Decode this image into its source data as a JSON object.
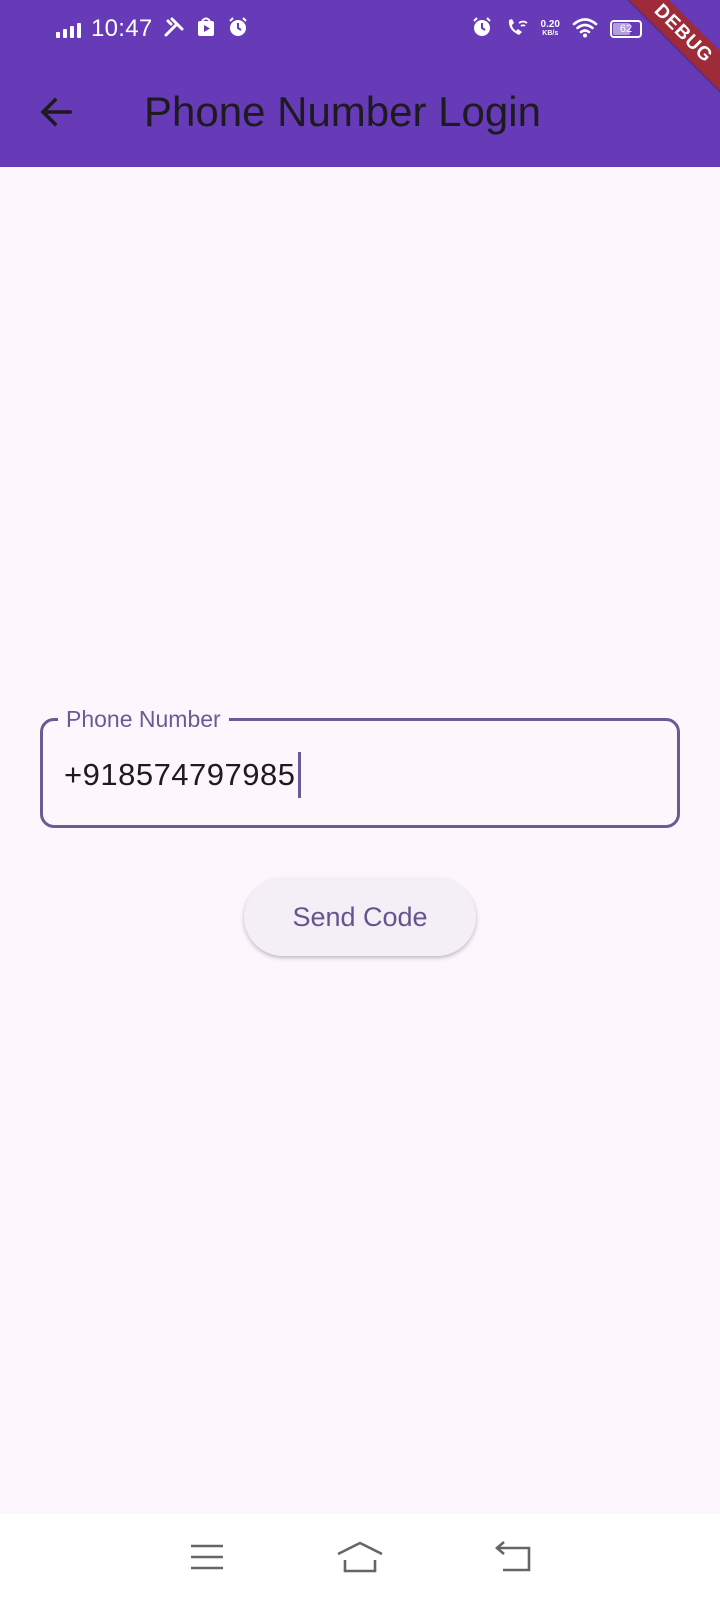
{
  "status_bar": {
    "time": "10:47",
    "net_speed_value": "0.20",
    "net_speed_unit": "KB/s",
    "battery_level": "62",
    "icons": [
      "signal-icon",
      "tools-icon",
      "play-store-icon",
      "alarm-icon",
      "alarm-icon",
      "wifi-call-icon",
      "wifi-icon",
      "battery-icon"
    ]
  },
  "debug_banner": "DEBUG",
  "app_bar": {
    "title": "Phone Number Login",
    "back_icon": "arrow-back-icon"
  },
  "phone_field": {
    "label": "Phone Number",
    "value": "+918574797985"
  },
  "send_button": {
    "label": "Send Code"
  },
  "nav_bar": {
    "icons": [
      "menu-icon",
      "home-icon",
      "back-icon"
    ]
  },
  "colors": {
    "app_bar": "#673AB7",
    "background": "#FDF7FD",
    "field_border": "#6B5B95",
    "button_text": "#65558F",
    "debug_ribbon": "#9E2A3A"
  }
}
